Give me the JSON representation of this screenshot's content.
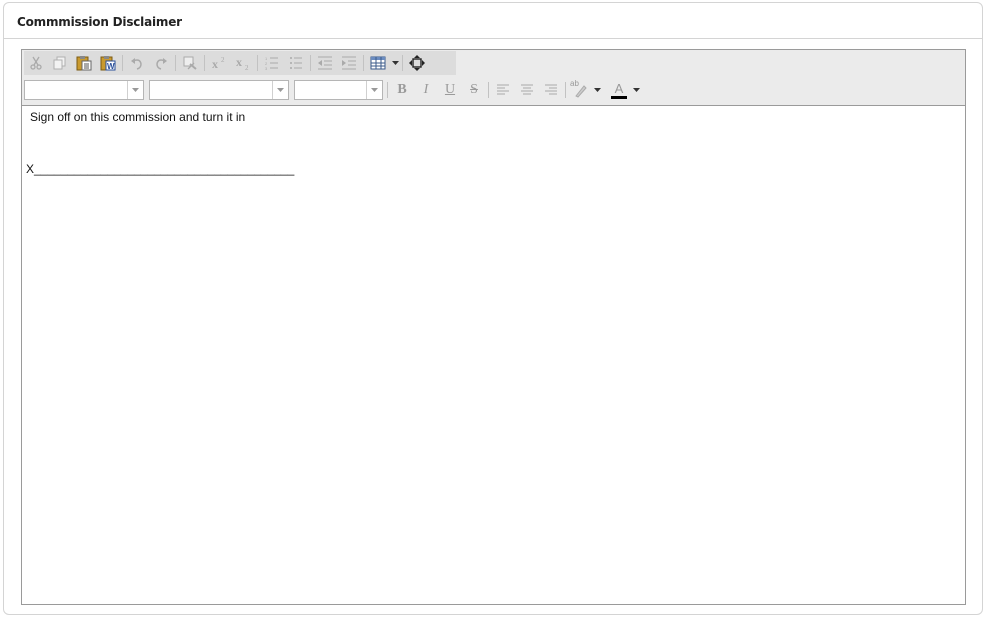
{
  "panel": {
    "title": "Commmission Disclaimer"
  },
  "editor": {
    "toolbar_row1": [
      {
        "icon": "cut-icon"
      },
      {
        "icon": "copy-icon"
      },
      {
        "icon": "paste-icon"
      },
      {
        "icon": "paste-from-word-icon"
      },
      {
        "icon": "undo-icon"
      },
      {
        "icon": "redo-icon"
      },
      {
        "icon": "format-stripper-icon"
      },
      {
        "icon": "superscript-icon"
      },
      {
        "icon": "subscript-icon"
      },
      {
        "icon": "numbered-list-icon"
      },
      {
        "icon": "bulleted-list-icon"
      },
      {
        "icon": "outdent-icon"
      },
      {
        "icon": "indent-icon"
      },
      {
        "icon": "insert-table-icon"
      },
      {
        "icon": "toggle-fullscreen-icon"
      }
    ],
    "font_name_value": "",
    "font_size_value": "",
    "paragraph_style_value": "",
    "format_labels": {
      "bold": "B",
      "italic": "I",
      "underline": "U",
      "strike": "S",
      "forecolor": "A",
      "highlight": "ab"
    },
    "content_line1": "Sign off on this commission and turn it in",
    "content_line2": "X_______________________________________"
  },
  "colors": {
    "border": "#9a9a9a",
    "toolbar_bg": "#ebebeb",
    "icon_disabled": "#a8a8a8",
    "forecolor_bar": "#000000"
  }
}
